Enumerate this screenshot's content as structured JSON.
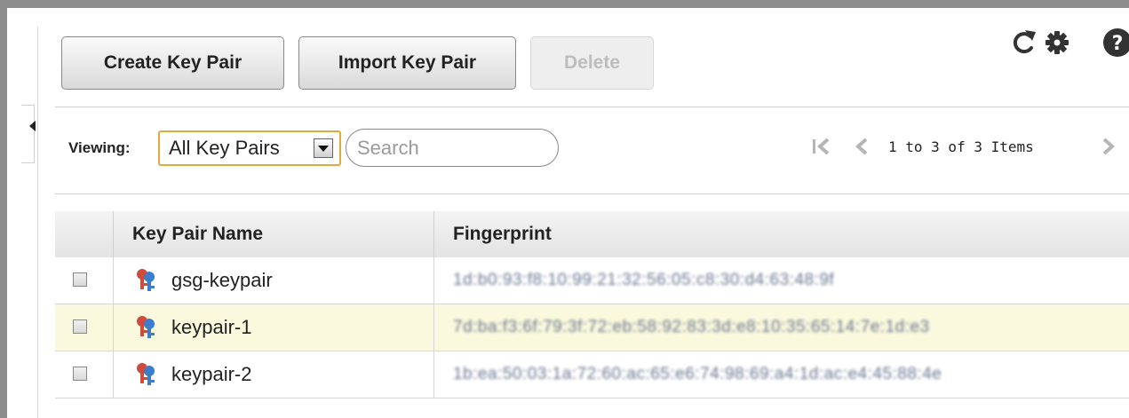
{
  "toolbar": {
    "create_label": "Create Key Pair",
    "import_label": "Import Key Pair",
    "delete_label": "Delete"
  },
  "icons": {
    "refresh": "refresh-icon",
    "settings": "gear-icon",
    "help": "help-icon",
    "collapse": "chevron-left-icon",
    "key": "key-icon"
  },
  "filter": {
    "viewing_label": "Viewing:",
    "selected_option": "All Key Pairs",
    "search_placeholder": "Search"
  },
  "pagination": {
    "summary": "1 to 3 of 3 Items"
  },
  "table": {
    "columns": [
      "Key Pair Name",
      "Fingerprint"
    ],
    "rows": [
      {
        "name": "gsg-keypair",
        "fingerprint": "1d:b0:93:f8:10:99:21:32:56:05:c8:30:d4:63:48:9f",
        "highlight": false
      },
      {
        "name": "keypair-1",
        "fingerprint": "7d:ba:f3:6f:79:3f:72:eb:58:92:83:3d:e8:10:35:65:14:7e:1d:e3",
        "highlight": true
      },
      {
        "name": "keypair-2",
        "fingerprint": "1b:ea:50:03:1a:72:60:ac:65:e6:74:98:69:a4:1d:ac:e4:45:88:4e",
        "highlight": false
      }
    ]
  },
  "colors": {
    "frame": "#8c8c8c",
    "select_border": "#e1a941",
    "highlight_row": "#fbf9dd"
  }
}
